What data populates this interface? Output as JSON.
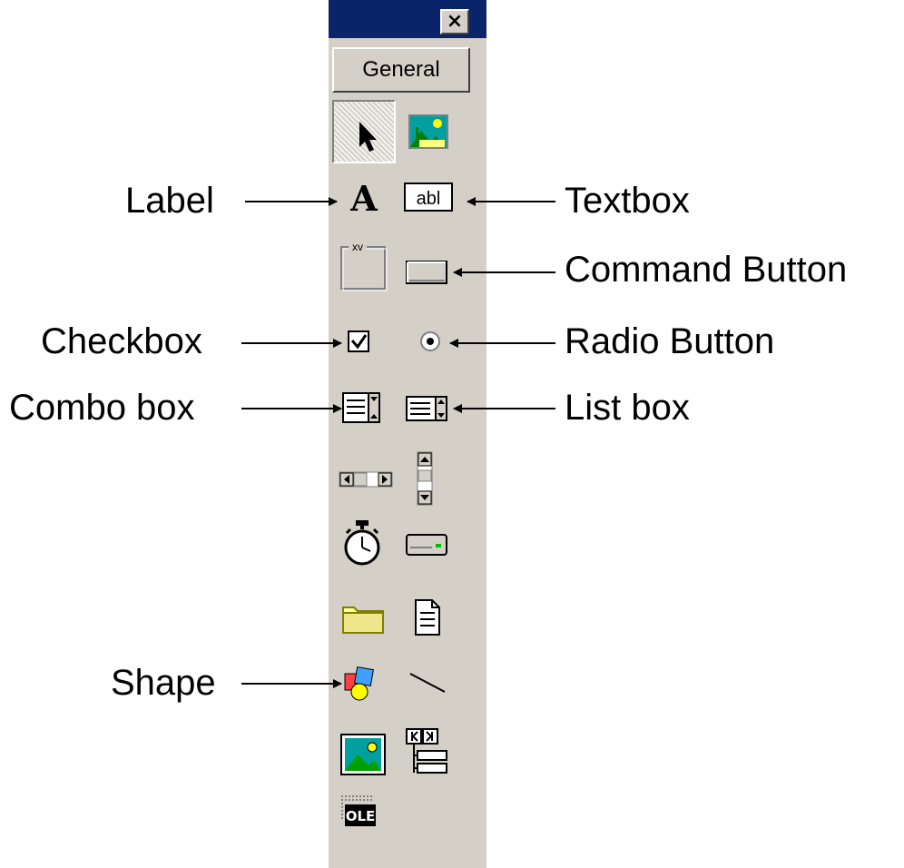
{
  "toolbox": {
    "close_label": "×",
    "tab_label": "General",
    "tools": [
      {
        "name": "pointer",
        "icon": "pointer-arrow-icon"
      },
      {
        "name": "picturebox",
        "icon": "picturebox-icon"
      },
      {
        "name": "label",
        "icon": "label-icon"
      },
      {
        "name": "textbox",
        "icon": "textbox-icon"
      },
      {
        "name": "frame",
        "icon": "frame-icon"
      },
      {
        "name": "command-button",
        "icon": "command-button-icon"
      },
      {
        "name": "checkbox",
        "icon": "checkbox-icon"
      },
      {
        "name": "option-button",
        "icon": "radio-button-icon"
      },
      {
        "name": "combobox",
        "icon": "combobox-icon"
      },
      {
        "name": "listbox",
        "icon": "listbox-icon"
      },
      {
        "name": "hscrollbar",
        "icon": "hscrollbar-icon"
      },
      {
        "name": "vscrollbar",
        "icon": "vscrollbar-icon"
      },
      {
        "name": "timer",
        "icon": "timer-icon"
      },
      {
        "name": "drivelistbox",
        "icon": "drive-icon"
      },
      {
        "name": "dirlistbox",
        "icon": "folder-icon"
      },
      {
        "name": "filelistbox",
        "icon": "file-icon"
      },
      {
        "name": "shape",
        "icon": "shape-icon"
      },
      {
        "name": "line",
        "icon": "line-icon"
      },
      {
        "name": "image",
        "icon": "image-icon"
      },
      {
        "name": "data",
        "icon": "data-control-icon"
      },
      {
        "name": "ole",
        "icon": "ole-icon"
      }
    ],
    "ole_text": "OLE",
    "textbox_text": "abl",
    "frame_text": "xv"
  },
  "annotations": {
    "label": "Label",
    "textbox": "Textbox",
    "command_button": "Command Button",
    "checkbox": "Checkbox",
    "radio_button": "Radio Button",
    "combo_box": "Combo box",
    "list_box": "List box",
    "shape": "Shape"
  },
  "colors": {
    "titlebar": "#0a246a",
    "panel": "#d4d0c8"
  }
}
